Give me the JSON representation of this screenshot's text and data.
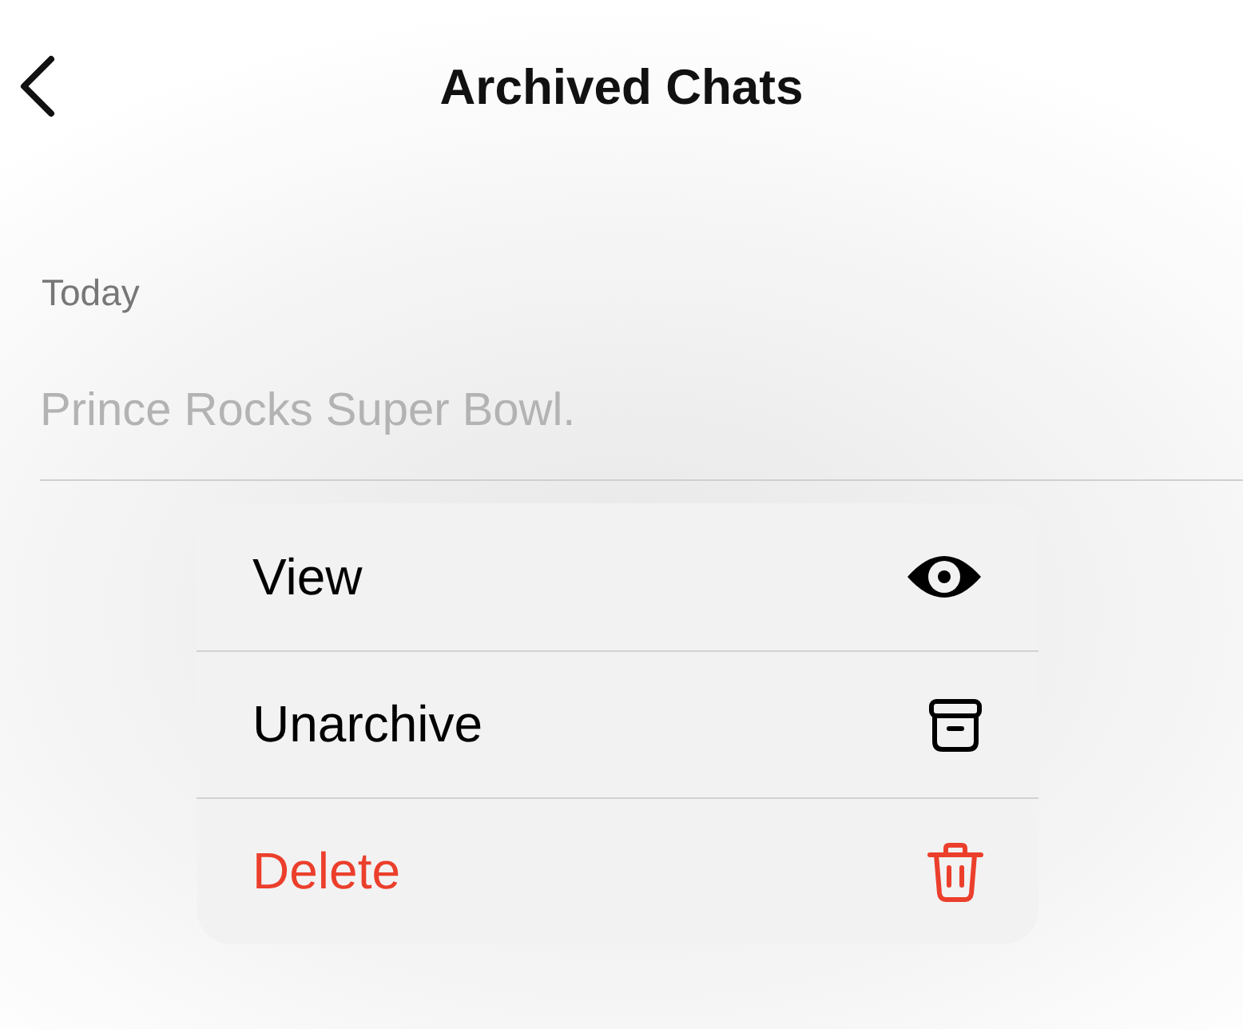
{
  "header": {
    "title": "Archived Chats"
  },
  "section": {
    "label": "Today"
  },
  "chats": [
    {
      "title": "Prince Rocks Super Bowl."
    }
  ],
  "context_menu": {
    "items": [
      {
        "label": "View",
        "kind": "view",
        "destructive": false
      },
      {
        "label": "Unarchive",
        "kind": "unarchive",
        "destructive": false
      },
      {
        "label": "Delete",
        "kind": "delete",
        "destructive": true
      }
    ]
  }
}
